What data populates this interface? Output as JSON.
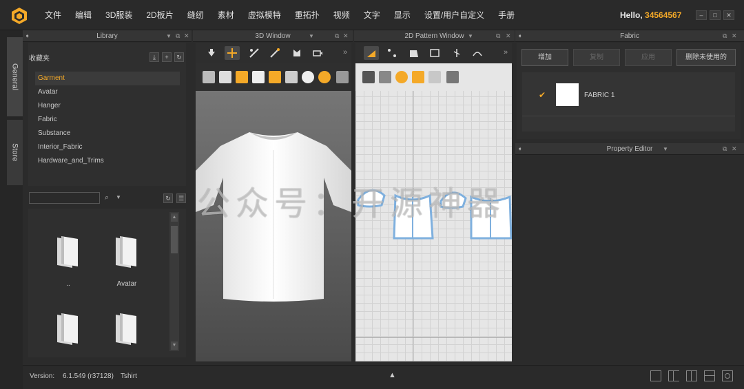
{
  "menubar": {
    "items": [
      "文件",
      "编辑",
      "3D服装",
      "2D板片",
      "缝纫",
      "素材",
      "虚拟模特",
      "重拓扑",
      "视频",
      "文字",
      "显示",
      "设置/用户自定义",
      "手册"
    ],
    "hello_prefix": "Hello, ",
    "username": "34564567"
  },
  "left_tabs": [
    "General",
    "Store"
  ],
  "library": {
    "title": "Library",
    "favorites_title": "收藏夹",
    "items": [
      "Garment",
      "Avatar",
      "Hanger",
      "Fabric",
      "Substance",
      "Interior_Fabric",
      "Hardware_and_Trims"
    ],
    "selected": "Garment",
    "search_value": "",
    "files": [
      "..",
      "Avatar",
      "",
      ""
    ]
  },
  "window3d": {
    "title": "3D Window"
  },
  "window2d": {
    "title": "2D Pattern Window"
  },
  "fabric": {
    "title": "Fabric",
    "buttons": {
      "add": "增加",
      "copy": "复制",
      "apply": "应用",
      "delete_unused": "删除未使用的"
    },
    "items": [
      {
        "name": "FABRIC 1",
        "checked": true
      }
    ]
  },
  "property_editor": {
    "title": "Property Editor"
  },
  "status": {
    "version_label": "Version:",
    "version_value": "6.1.549 (r37128)",
    "project_name": "Tshirt"
  },
  "watermark": "公众号：开源神器",
  "colors": {
    "accent": "#f4a928",
    "pattern_outline": "#7fb0de"
  }
}
